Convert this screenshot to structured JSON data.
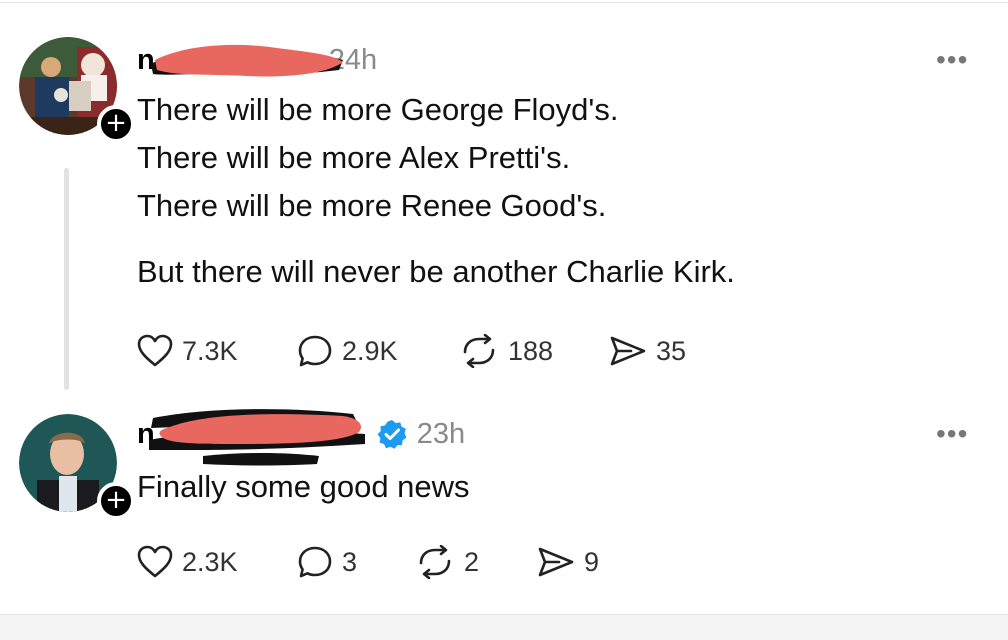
{
  "posts": [
    {
      "username": "n",
      "timestamp": "24h",
      "lines": [
        "There will be more George Floyd's.",
        "There will be more Alex Pretti's.",
        "There will be more Renee Good's.",
        "But there will never be another Charlie Kirk."
      ],
      "stats": {
        "likes": "7.3K",
        "replies": "2.9K",
        "reposts": "188",
        "shares": "35"
      },
      "more_label": "•••",
      "follow_label": "+"
    },
    {
      "username": "n",
      "timestamp": "23h",
      "verified": true,
      "lines": [
        "Finally some good news"
      ],
      "stats": {
        "likes": "2.3K",
        "replies": "3",
        "reposts": "2",
        "shares": "9"
      },
      "more_label": "•••",
      "follow_label": "+"
    }
  ],
  "colors": {
    "redaction_red": "#e8685f",
    "redaction_black": "#111111",
    "verified_blue": "#1d9bf0",
    "timestamp_gray": "#8a8a8a"
  },
  "icons": {
    "like": "heart-icon",
    "reply": "speech-bubble-icon",
    "repost": "repost-arrows-icon",
    "share": "send-arrow-icon",
    "more": "ellipsis-icon",
    "verified": "verified-badge-icon"
  }
}
